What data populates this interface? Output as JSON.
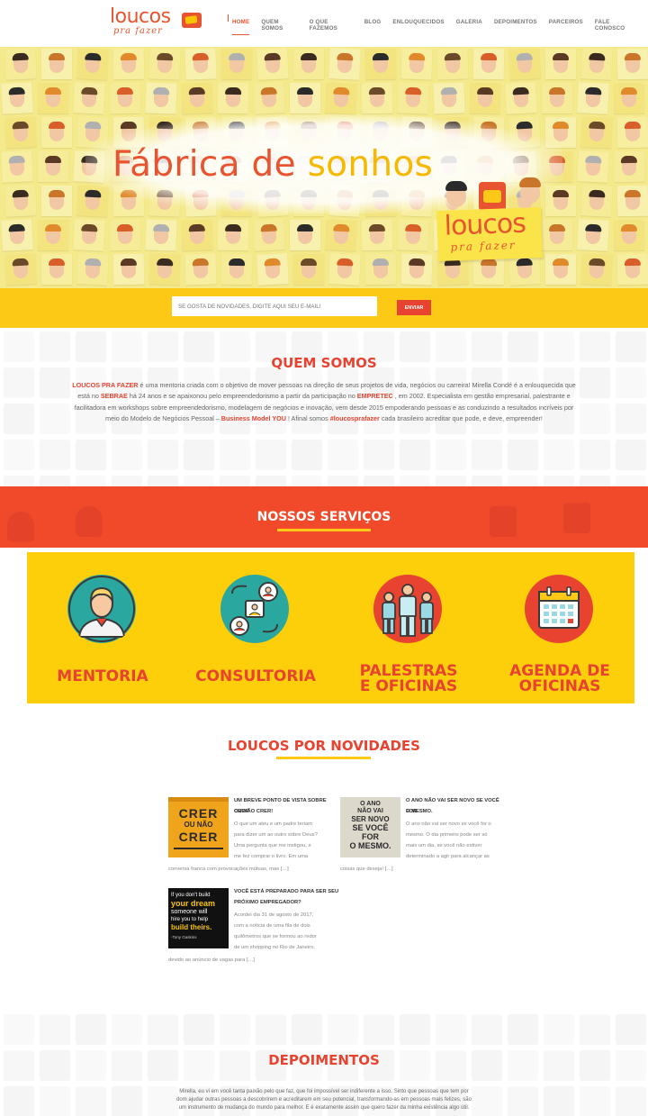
{
  "brand": {
    "logo_main": "loucos",
    "logo_sub": "pra fazer",
    "accent": "#e8542f",
    "yellow": "#fbc916"
  },
  "nav": {
    "items": [
      "HOME",
      "QUEM SOMOS",
      "O QUE FAZEMOS",
      "BLOG",
      "ENLOUQUECIDOS",
      "GALERIA",
      "DEPOIMENTOS",
      "PARCEIROS",
      "FALE CONOSCO"
    ],
    "active": "HOME"
  },
  "hero": {
    "title_part1": "Fábrica de ",
    "title_part2": "sonhos",
    "logo_main": "loucos",
    "logo_sub": "pra fazer"
  },
  "newsletter": {
    "placeholder": "SE GOSTA DE NOVIDADES, DIGITE AQUI SEU E-MAIL!",
    "button": "ENVIAR"
  },
  "about": {
    "title": "QUEM SOMOS",
    "brand_name": "LOUCOS PRA FAZER",
    "text_1": " é uma mentoria criada com o objetivo de mover pessoas na direção de seus projetos de vida, negócios ou carreira! Mirella Condé é a enlouquecida que está no ",
    "sebrae": "SEBRAE",
    "text_2": " há 24 anos e se apaixonou pelo empreendedorismo a partir da participação no ",
    "empretec": "EMPRETEC",
    "text_3": " , em 2002. Especialista em gestão empresarial, palestrante e facilitadora em workshops sobre empreendedorismo, modelagem de negócios e inovação, vem desde 2015 empoderando pessoas e as conduzindo a resultados incríveis por meio do Modelo de Negócios Pessoal – ",
    "bmy": "Business Model YOU",
    "text_4": " ! Afinal somos ",
    "hashtag": "#loucosprafazer",
    "text_5": " cada brasileiro acreditar que pode, e deve, empreender!"
  },
  "services": {
    "title": "NOSSOS SERVIÇOS",
    "items": [
      {
        "label_1": "MENTORIA",
        "label_2": "",
        "icon": "mentor-person-icon"
      },
      {
        "label_1": "CONSULTORIA",
        "label_2": "",
        "icon": "consulting-exchange-icon"
      },
      {
        "label_1": "PALESTRAS",
        "label_2": "E OFICINAS",
        "icon": "group-people-icon"
      },
      {
        "label_1": "AGENDA DE",
        "label_2": "OFICINAS",
        "icon": "calendar-icon"
      }
    ]
  },
  "news": {
    "title": "LOUCOS POR NOVIDADES",
    "posts": [
      {
        "title_1": "UM BREVE PONTO DE VISTA SOBRE CRER",
        "title_2": "OU NÃO CRER!",
        "ex_1": "O que um ateu e um padre teriam",
        "ex_2": "para dizer um ao outro sobre Deus?",
        "ex_3": "Uma pergunta que me instigou, e",
        "ex_4": "me fez comprar o livro. Em uma",
        "ex_5": "conversa franca com provocações mútuas, mas […]",
        "thumb_line1": "CRER",
        "thumb_line2": "OU NÃO",
        "thumb_line3": "CRER"
      },
      {
        "title_1": "O ANO NÃO VAI SER NOVO SE VOCÊ FOR",
        "title_2": "O MESMO.",
        "ex_1": "O ano não vai ser novo se você for o",
        "ex_2": "mesmo. O dia primeiro pode ser só",
        "ex_3": "mais um dia, se você não estiver",
        "ex_4": "determinado a agir para alcançar as",
        "ex_5": "coisas que deseja! […]",
        "thumb_line1": "O ANO",
        "thumb_line2": "NÃO VAI",
        "thumb_line3": "SER NOVO",
        "thumb_line4": "SE VOCÊ",
        "thumb_line5": "FOR",
        "thumb_line6": "O MESMO."
      },
      {
        "title_1": "VOCÊ ESTÁ PREPARADO PARA SER SEU",
        "title_2": "PRÓXIMO EMPREGADOR?",
        "ex_1": "Acordei dia 31 de agosto de 2017,",
        "ex_2": "com a notícia de uma fila de dois",
        "ex_3": "quilômetros que se formou ao redor",
        "ex_4": "de um shopping no Rio de Janeiro,",
        "ex_5": "devido ao anúncio de vagas para […]",
        "thumb_line1": "If you don't build",
        "thumb_line2": "your dream",
        "thumb_line3": "someone will",
        "thumb_line4": "hire you to help",
        "thumb_line5": "build theirs.",
        "thumb_line6": "-Tony Gaskins"
      }
    ]
  },
  "testimonials": {
    "title": "DEPOIMENTOS",
    "text": "Mirella, eu vi em você tanta paixão pelo que faz, que foi impossível ser indiferente a isso. Sinto que pessoas que tem por dom ajudar outras pessoas a descobrirem e acreditarem em seu potencial, transformando-as em pessoas mais felizes, são um instrumento de mudança do mundo para melhor. E é exatamente assim que quero fazer da minha existência algo útil."
  }
}
